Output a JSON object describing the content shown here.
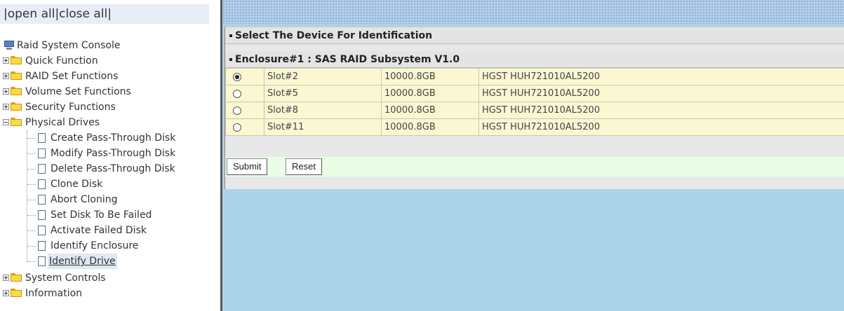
{
  "left_panel": {
    "open_all": "open all",
    "close_all": "close all",
    "tree": {
      "root": "Raid System Console",
      "items": [
        {
          "label": "Quick Function"
        },
        {
          "label": "RAID Set Functions"
        },
        {
          "label": "Volume Set Functions"
        },
        {
          "label": "Security Functions"
        },
        {
          "label": "Physical Drives",
          "expanded": true,
          "children": [
            "Create Pass-Through Disk",
            "Modify Pass-Through Disk",
            "Delete Pass-Through Disk",
            "Clone Disk",
            "Abort Cloning",
            "Set Disk To Be Failed",
            "Activate Failed Disk",
            "Identify Enclosure",
            "Identify Drive"
          ],
          "selected_child": "Identify Drive"
        },
        {
          "label": "System Controls"
        },
        {
          "label": "Information"
        }
      ]
    }
  },
  "main": {
    "section_title": "Select The Device For Identification",
    "enclosure_title": "Enclosure#1 : SAS RAID Subsystem V1.0",
    "drives": [
      {
        "slot": "Slot#2",
        "capacity": "10000.8GB",
        "model": "HGST HUH721010AL5200",
        "selected": true
      },
      {
        "slot": "Slot#5",
        "capacity": "10000.8GB",
        "model": "HGST HUH721010AL5200",
        "selected": false
      },
      {
        "slot": "Slot#8",
        "capacity": "10000.8GB",
        "model": "HGST HUH721010AL5200",
        "selected": false
      },
      {
        "slot": "Slot#11",
        "capacity": "10000.8GB",
        "model": "HGST HUH721010AL5200",
        "selected": false
      }
    ],
    "submit_label": "Submit",
    "reset_label": "Reset"
  },
  "colors": {
    "main_background": "#acd3e7",
    "row_background": "#fbf7d3",
    "button_row_background": "#eafde6"
  }
}
